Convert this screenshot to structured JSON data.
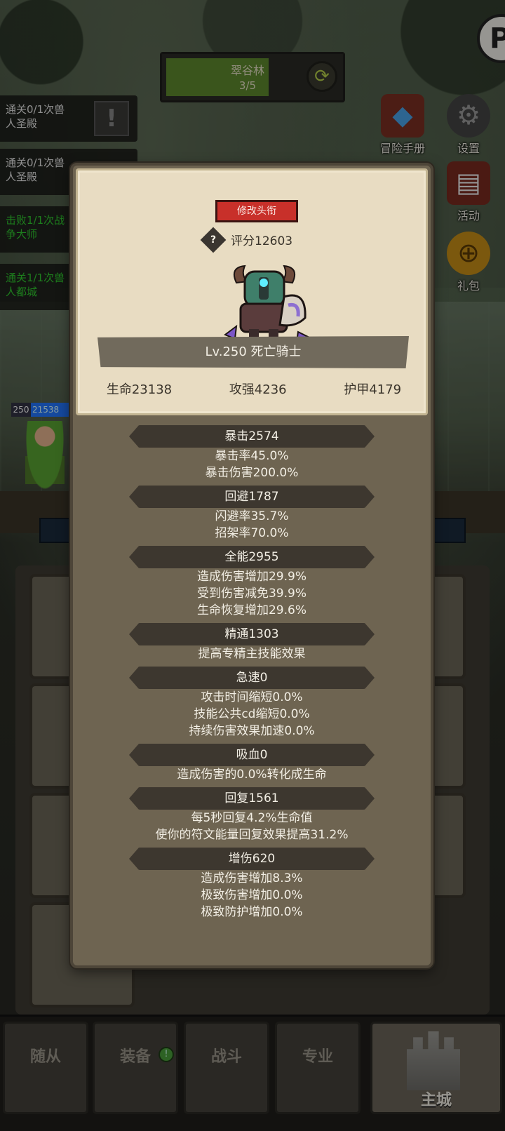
{
  "hud": {
    "zone_name": "翠谷林",
    "zone_progress": "3/5",
    "zone_progress_fraction": 0.6,
    "corner_letter": "P"
  },
  "quests": [
    {
      "text_1": "通关0/1次兽",
      "text_2": "人圣殿",
      "status": "todo"
    },
    {
      "text_1": "通关0/1次兽",
      "text_2": "人圣殿",
      "status": "todo"
    },
    {
      "text_1": "击败1/1次战",
      "text_2": "争大师",
      "status": "done"
    },
    {
      "text_1": "通关1/1次兽",
      "text_2": "人都城",
      "status": "done"
    }
  ],
  "side_menu": {
    "handbook": "冒险手册",
    "settings": "设置",
    "events": "活动",
    "gifts": "礼包"
  },
  "bg_hero": {
    "level": "250",
    "bar_value": "21538"
  },
  "panel": {
    "rename_button": "修改头衔",
    "score": "评分12603",
    "hero_name": "Lv.250 死亡骑士",
    "base_stats": {
      "hp": "生命23138",
      "attack": "攻强4236",
      "armor": "护甲4179"
    }
  },
  "stat_groups": [
    {
      "title": "暴击2574",
      "lines": [
        "暴击率45.0%",
        "暴击伤害200.0%"
      ]
    },
    {
      "title": "回避1787",
      "lines": [
        "闪避率35.7%",
        "招架率70.0%"
      ]
    },
    {
      "title": "全能2955",
      "lines": [
        "造成伤害增加29.9%",
        "受到伤害减免39.9%",
        "生命恢复增加29.6%"
      ]
    },
    {
      "title": "精通1303",
      "lines": [
        "提高专精主技能效果"
      ]
    },
    {
      "title": "急速0",
      "lines": [
        "攻击时间缩短0.0%",
        "技能公共cd缩短0.0%",
        "持续伤害效果加速0.0%"
      ]
    },
    {
      "title": "吸血0",
      "lines": [
        "造成伤害的0.0%转化成生命"
      ]
    },
    {
      "title": "回复1561",
      "lines": [
        "每5秒回复4.2%生命值",
        "使你的符文能量回复效果提高31.2%"
      ]
    },
    {
      "title": "增伤620",
      "lines": [
        "造成伤害增加8.3%",
        "极致伤害增加0.0%",
        "极致防护增加0.0%"
      ]
    }
  ],
  "bottom_nav": {
    "followers": "随从",
    "equipment": "装备",
    "battle": "战斗",
    "profession": "专业",
    "main_city": "主城",
    "active_tab": "主城"
  },
  "colors": {
    "panel_bg": "#6e6451",
    "panel_top_bg": "#e8dcc2",
    "header_bg": "#3d372f",
    "rename_red": "#c8302a",
    "quest_done_green": "#2fcb2f"
  },
  "icons": {
    "help": "question-diamond-icon",
    "swap": "swap-arrows-icon",
    "settings": "gear-icon",
    "alert": "exclamation-icon"
  }
}
